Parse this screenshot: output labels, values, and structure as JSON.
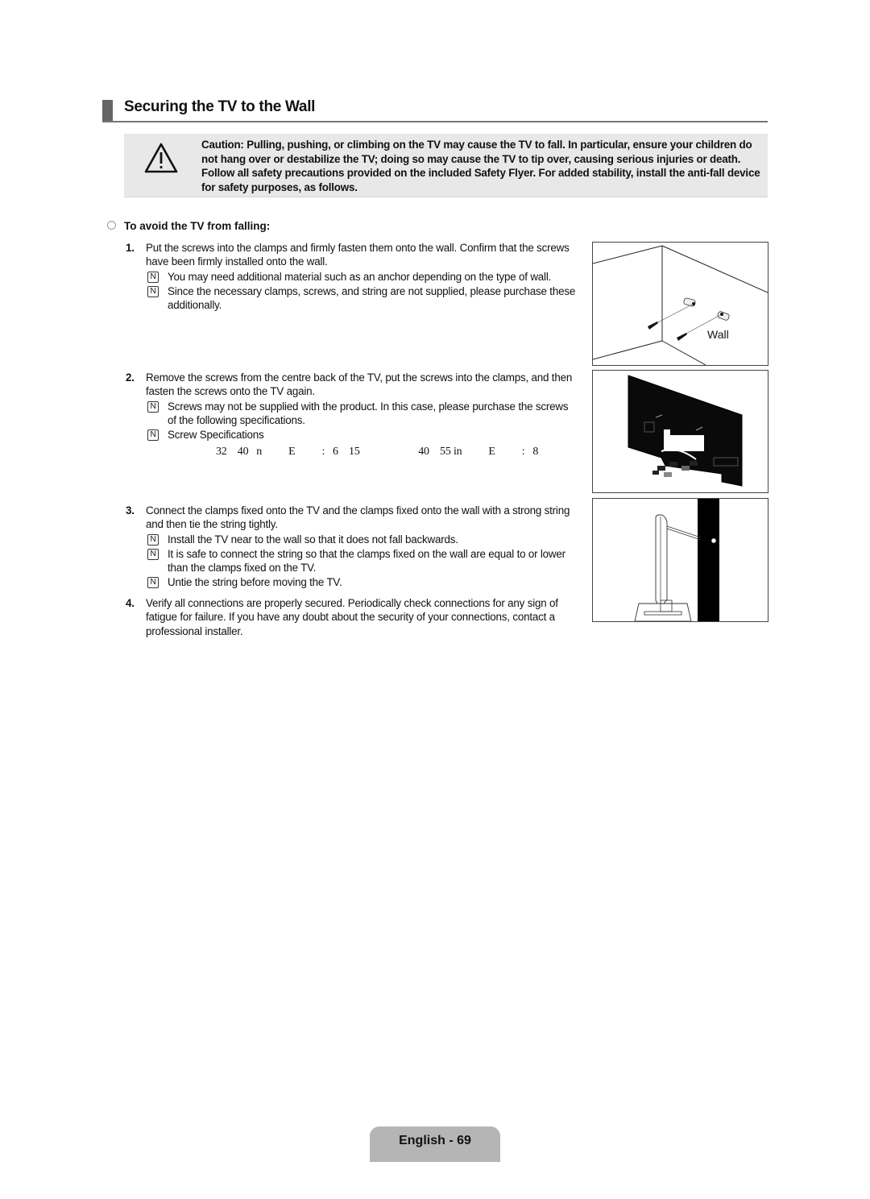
{
  "title": "Securing the TV to the Wall",
  "caution": {
    "icon": "warning-triangle-icon",
    "text": "Caution: Pulling, pushing, or climbing on the TV may cause the TV to fall. In particular, ensure your children do not hang over or destabilize the TV; doing so may cause the TV to tip over, causing serious injuries or death. Follow all safety precautions provided on the included Safety Flyer. For added stability, install the anti-fall device for safety purposes, as follows."
  },
  "subheading": "To avoid the TV from falling:",
  "steps": [
    {
      "num": "1.",
      "text": "Put the screws into the clamps and firmly fasten them onto the wall. Confirm that the screws have been firmly installed onto the wall.",
      "notes": [
        "You may need additional material such as an anchor depending on the type of wall.",
        "Since the necessary clamps, screws, and string are not supplied, please purchase these additionally."
      ]
    },
    {
      "num": "2.",
      "text": "Remove the screws from the centre back of the TV, put the screws into the clamps, and then fasten the screws onto the TV again.",
      "notes": [
        "Screws may not be supplied with the product. In this case, please purchase the screws of the following specifications.",
        "Screw Specifications"
      ],
      "spec_line": "32    40   n          E          :   6    15                      40    55 in          E          :   8"
    },
    {
      "num": "3.",
      "text": "Connect the clamps fixed onto the TV and the clamps fixed onto the wall with a strong string and then tie the string tightly.",
      "notes": [
        "Install the TV near to the wall so that it does not fall backwards.",
        "It is safe to connect the string so that the clamps fixed on the wall are equal to or lower than the clamps fixed on the TV.",
        "Untie the string before moving the TV."
      ]
    },
    {
      "num": "4.",
      "text": "Verify all connections are properly secured. Periodically check connections for any sign of fatigue for failure. If you have any doubt about the security of your connections, contact a professional installer.",
      "notes": []
    }
  ],
  "figures": {
    "wall_label": "Wall"
  },
  "note_icon": "N",
  "footer": "English - 69"
}
